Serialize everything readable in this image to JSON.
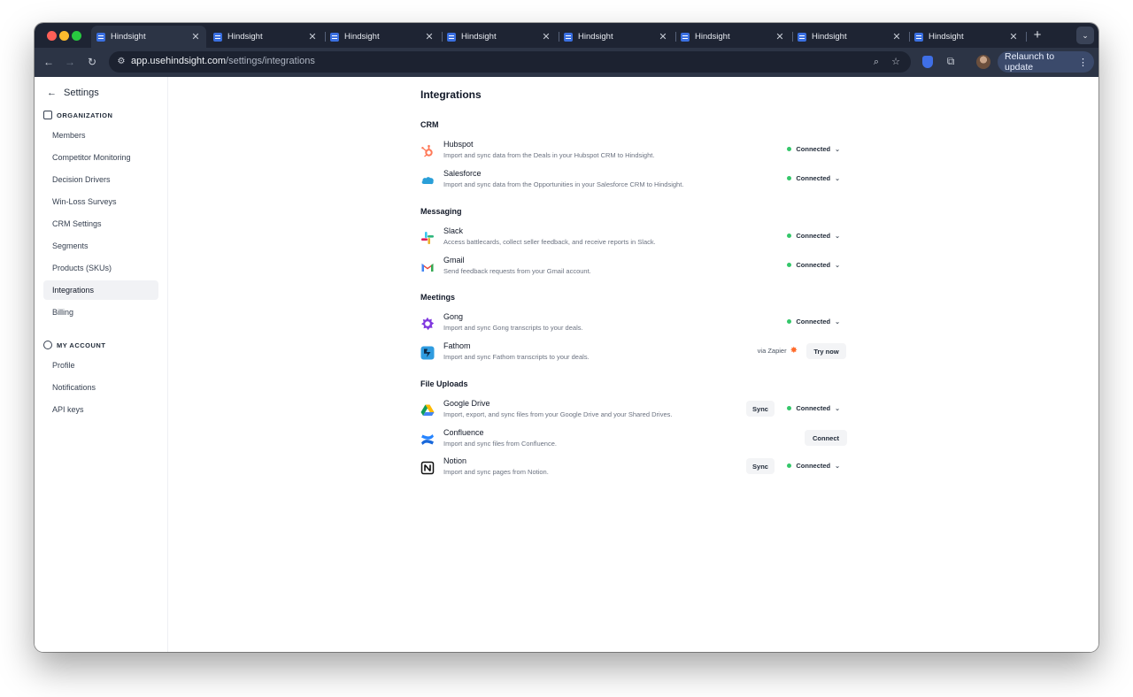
{
  "browser": {
    "tabs": [
      {
        "title": "Hindsight",
        "active": true
      },
      {
        "title": "Hindsight",
        "active": false
      },
      {
        "title": "Hindsight",
        "active": false
      },
      {
        "title": "Hindsight",
        "active": false
      },
      {
        "title": "Hindsight",
        "active": false
      },
      {
        "title": "Hindsight",
        "active": false
      },
      {
        "title": "Hindsight",
        "active": false
      },
      {
        "title": "Hindsight",
        "active": false
      }
    ],
    "tab_close_glyph": "✕",
    "new_tab_glyph": "+",
    "url_host": "app.usehindsight.com",
    "url_path": "/settings/integrations",
    "relaunch_label": "Relaunch to update"
  },
  "sidebar": {
    "title": "Settings",
    "organization_label": "ORGANIZATION",
    "organization_items": [
      "Members",
      "Competitor Monitoring",
      "Decision Drivers",
      "Win-Loss Surveys",
      "CRM Settings",
      "Segments",
      "Products (SKUs)",
      "Integrations",
      "Billing"
    ],
    "active_item": "Integrations",
    "account_label": "MY ACCOUNT",
    "account_items": [
      "Profile",
      "Notifications",
      "API keys"
    ]
  },
  "main": {
    "title": "Integrations",
    "groups": [
      {
        "title": "CRM",
        "items": [
          {
            "name": "Hubspot",
            "desc": "Import and sync data from the Deals in your Hubspot CRM to Hindsight.",
            "status": "Connected",
            "icon": "hubspot-icon"
          },
          {
            "name": "Salesforce",
            "desc": "Import and sync data from the Opportunities in your Salesforce CRM to Hindsight.",
            "status": "Connected",
            "icon": "salesforce-icon"
          }
        ]
      },
      {
        "title": "Messaging",
        "items": [
          {
            "name": "Slack",
            "desc": "Access battlecards, collect seller feedback, and receive reports in Slack.",
            "status": "Connected",
            "icon": "slack-icon"
          },
          {
            "name": "Gmail",
            "desc": "Send feedback requests from your Gmail account.",
            "status": "Connected",
            "icon": "gmail-icon"
          }
        ]
      },
      {
        "title": "Meetings",
        "items": [
          {
            "name": "Gong",
            "desc": "Import and sync Gong transcripts to your deals.",
            "status": "Connected",
            "icon": "gong-icon"
          },
          {
            "name": "Fathom",
            "desc": "Import and sync Fathom transcripts to your deals.",
            "via": "via Zapier",
            "button": "Try now",
            "icon": "fathom-icon"
          }
        ]
      },
      {
        "title": "File Uploads",
        "items": [
          {
            "name": "Google Drive",
            "desc": "Import, export, and sync files from your Google Drive and your Shared Drives.",
            "button": "Sync",
            "status": "Connected",
            "icon": "google-drive-icon"
          },
          {
            "name": "Confluence",
            "desc": "Import and sync files from Confluence.",
            "button": "Connect",
            "icon": "confluence-icon"
          },
          {
            "name": "Notion",
            "desc": "Import and sync pages from Notion.",
            "button": "Sync",
            "status": "Connected",
            "icon": "notion-icon"
          }
        ]
      }
    ]
  },
  "colors": {
    "connected_dot": "#34c76a",
    "browser_chrome": "#1e2433",
    "toolbar": "#2c3445",
    "relaunch_button": "#3b4a6b"
  }
}
